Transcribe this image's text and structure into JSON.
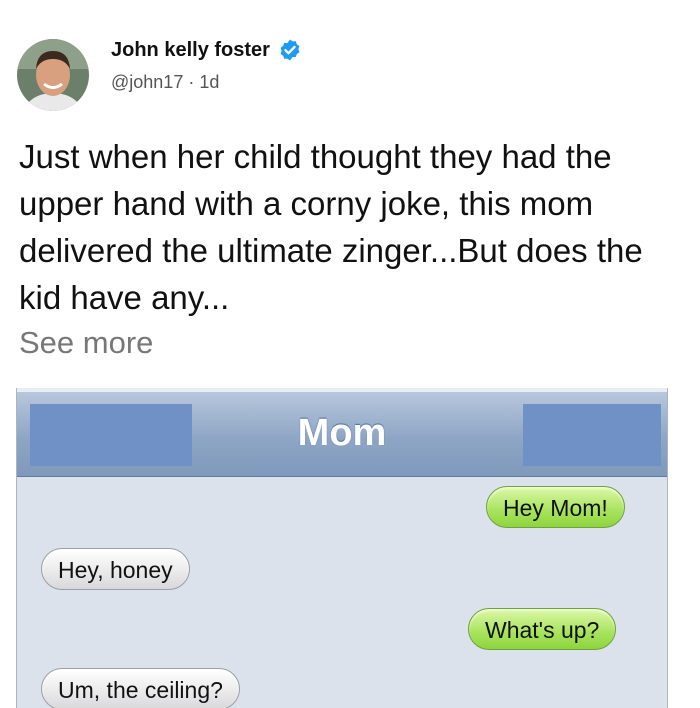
{
  "author": {
    "name": "John kelly foster",
    "handle": "@john17",
    "separator": "·",
    "time": "1d"
  },
  "post": {
    "text": "Just when her child thought they had the upper hand with a corny joke, this mom delivered the ultimate zinger...But does the kid have any...",
    "see_more": "See more"
  },
  "screenshot": {
    "title": "Mom",
    "messages": [
      {
        "direction": "outgoing",
        "text": "Hey Mom!"
      },
      {
        "direction": "incoming",
        "text": "Hey, honey"
      },
      {
        "direction": "outgoing",
        "text": "What's up?"
      },
      {
        "direction": "incoming",
        "text": "Um, the ceiling?"
      }
    ]
  },
  "colors": {
    "verified_badge": "#1d9bf0",
    "outgoing_bubble": "#a7e35c",
    "incoming_bubble": "#e9e9ea",
    "header_bar": "#8ea6c5"
  }
}
